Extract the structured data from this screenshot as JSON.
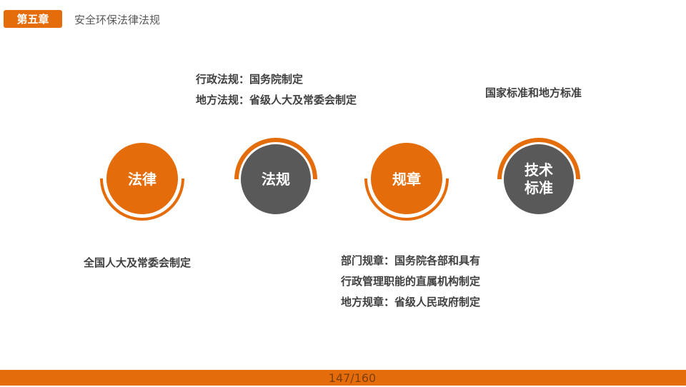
{
  "header": {
    "chapter_label": "第五章",
    "title": "安全环保法律法规"
  },
  "colors": {
    "accent": "#e46c0a",
    "dark_circle": "#595959",
    "text": "#404040"
  },
  "nodes": [
    {
      "label": "法律",
      "fill": "orange"
    },
    {
      "label": "法规",
      "fill": "dark"
    },
    {
      "label": "规章",
      "fill": "orange"
    },
    {
      "label": "技术标准",
      "fill": "dark"
    }
  ],
  "annotations": {
    "law": [
      "全国人大及常委会制定"
    ],
    "regulations": [
      "行政法规：国务院制定",
      "地方法规：省级人大及常委会制定"
    ],
    "rules": [
      "部门规章：国务院各部和具有",
      "行政管理职能的直属机构制定",
      "地方规章：省级人民政府制定"
    ],
    "standards": [
      "国家标准和地方标准"
    ]
  },
  "footer": {
    "page_number": "147/160"
  }
}
